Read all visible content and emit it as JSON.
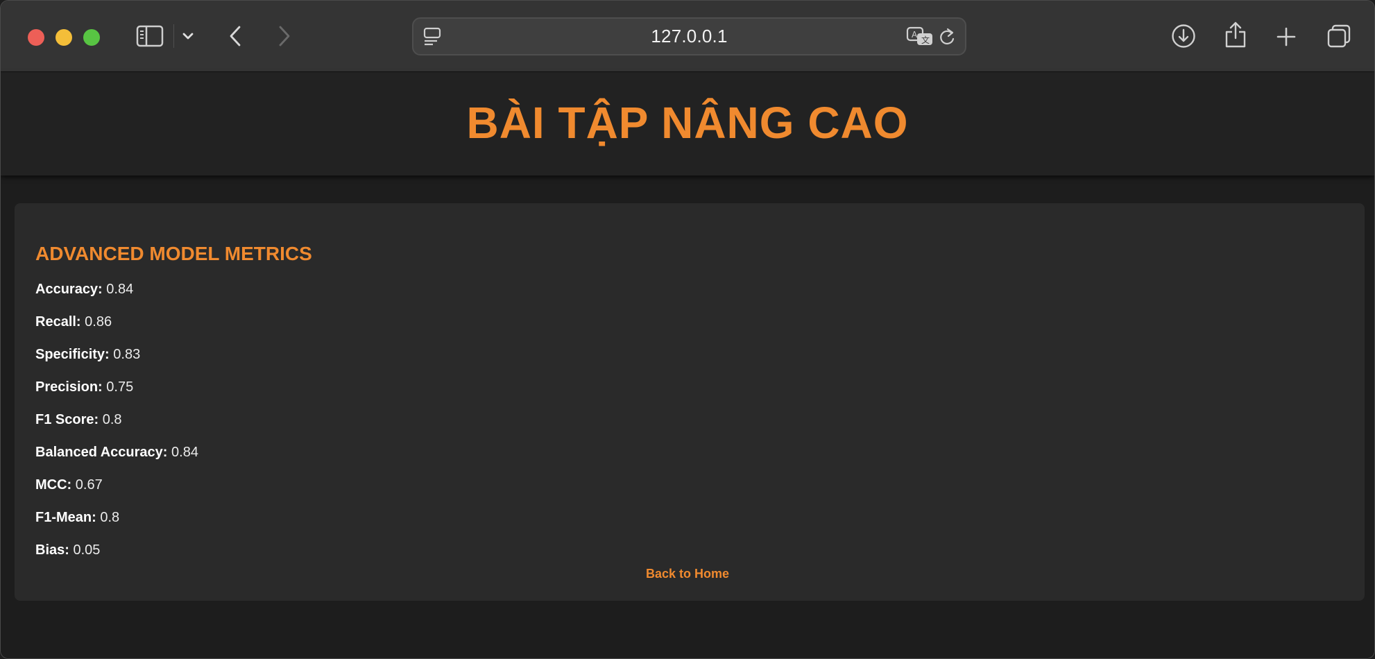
{
  "browser": {
    "url": "127.0.0.1",
    "icons": {
      "close": "close-window",
      "minimize": "minimize-window",
      "maximize": "maximize-window",
      "sidebar": "sidebar-icon",
      "sidebar_menu": "chevron-down-icon",
      "back": "back-arrow-icon",
      "forward": "forward-arrow-icon",
      "reader": "reader-mode-icon",
      "translate": "translate-icon",
      "reload": "reload-icon",
      "downloads": "download-icon",
      "share": "share-icon",
      "new_tab": "plus-icon",
      "tabs": "tab-overview-icon"
    }
  },
  "page": {
    "title": "BÀI TẬP NÂNG CAO",
    "section_title": "ADVANCED MODEL METRICS",
    "metrics": [
      {
        "label": "Accuracy:",
        "value": "0.84"
      },
      {
        "label": "Recall:",
        "value": "0.86"
      },
      {
        "label": "Specificity:",
        "value": "0.83"
      },
      {
        "label": "Precision:",
        "value": "0.75"
      },
      {
        "label": "F1 Score:",
        "value": "0.8"
      },
      {
        "label": "Balanced Accuracy:",
        "value": "0.84"
      },
      {
        "label": "MCC:",
        "value": "0.67"
      },
      {
        "label": "F1-Mean:",
        "value": "0.8"
      },
      {
        "label": "Bias:",
        "value": "0.05"
      }
    ],
    "back_link": "Back to Home"
  },
  "colors": {
    "accent": "#f08a2f",
    "background": "#1d1d1d",
    "card": "#2a2a2a",
    "toolbar": "#343434"
  }
}
